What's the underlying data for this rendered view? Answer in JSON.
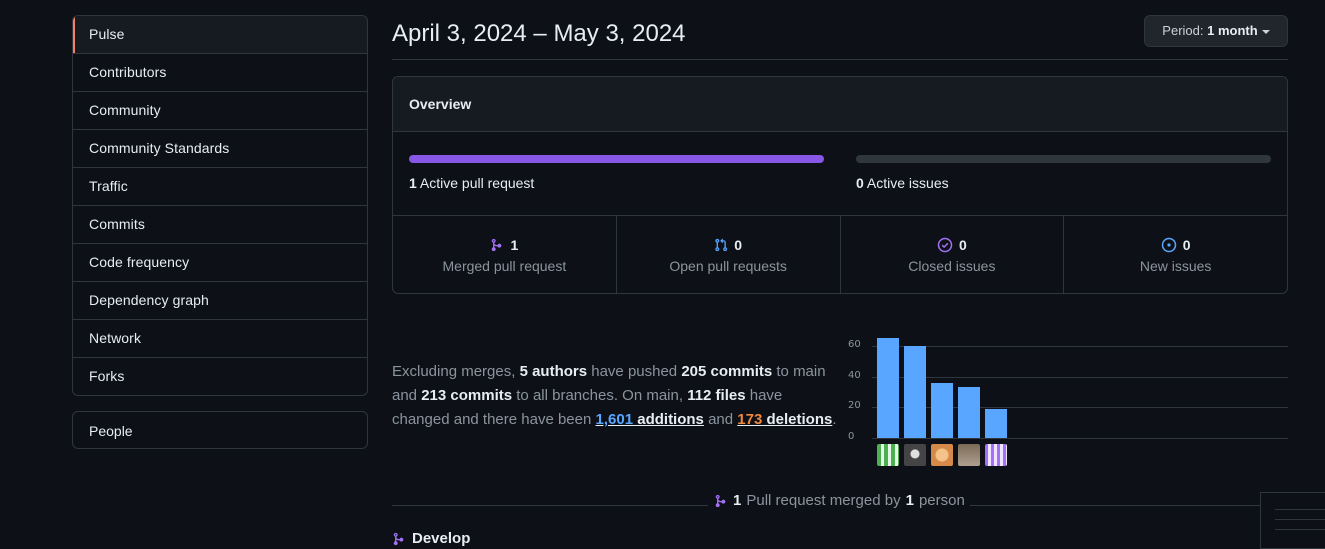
{
  "sidebar": {
    "items": [
      {
        "label": "Pulse",
        "selected": true
      },
      {
        "label": "Contributors"
      },
      {
        "label": "Community"
      },
      {
        "label": "Community Standards"
      },
      {
        "label": "Traffic"
      },
      {
        "label": "Commits"
      },
      {
        "label": "Code frequency"
      },
      {
        "label": "Dependency graph"
      },
      {
        "label": "Network"
      },
      {
        "label": "Forks"
      }
    ],
    "people_label": "People"
  },
  "header": {
    "title": "April 3, 2024 – May 3, 2024",
    "period_prefix": "Period:",
    "period_value": "1 month"
  },
  "overview": {
    "heading": "Overview",
    "active_prs_count": "1",
    "active_prs_label": "Active pull request",
    "active_issues_count": "0",
    "active_issues_label": "Active issues",
    "stats": [
      {
        "count": "1",
        "label": "Merged pull request",
        "icon": "merge-icon",
        "color": "#a371f7"
      },
      {
        "count": "0",
        "label": "Open pull requests",
        "icon": "pull-request-icon",
        "color": "#58a6ff"
      },
      {
        "count": "0",
        "label": "Closed issues",
        "icon": "issue-closed-icon",
        "color": "#a371f7"
      },
      {
        "count": "0",
        "label": "New issues",
        "icon": "issue-open-icon",
        "color": "#58a6ff"
      }
    ]
  },
  "summary": {
    "t1": "Excluding merges, ",
    "authors": "5 authors",
    "t2": " have pushed ",
    "commits_main": "205 commits",
    "t3": " to main and ",
    "commits_all": "213 commits",
    "t4": " to all branches. On main, ",
    "files": "112 files",
    "t5": " have changed and there have been ",
    "additions_num": "1,601",
    "additions_word": " additions",
    "t6": " and ",
    "deletions_num": "173",
    "deletions_word": " deletions",
    "t7": "."
  },
  "chart_data": {
    "type": "bar",
    "categories": [
      "author-1",
      "author-2",
      "author-3",
      "author-4",
      "author-5"
    ],
    "values": [
      65,
      60,
      36,
      33,
      19
    ],
    "ylim": [
      0,
      60
    ],
    "yticks": [
      "60",
      "40",
      "20",
      "0"
    ],
    "bar_color": "#58a6ff",
    "grid": true
  },
  "merged": {
    "count": "1",
    "text1": "Pull request merged by",
    "people": "1",
    "text2": "person"
  },
  "develop": {
    "label": "Develop"
  },
  "colors": {
    "accent_pr": "#8957e5",
    "selected_marker": "#f78166",
    "additions": "#58a6ff",
    "deletions": "#f0883e"
  }
}
